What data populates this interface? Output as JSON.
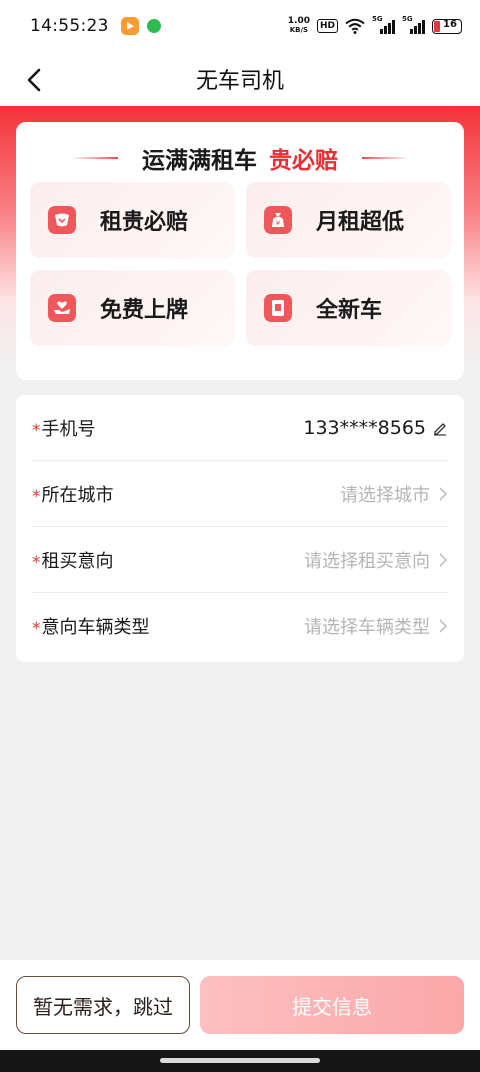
{
  "status_bar": {
    "time": "14:55:23",
    "net_speed_value": "1.00",
    "net_speed_unit": "KB/S",
    "hd_badge": "HD",
    "signal_1_label": "5G",
    "signal_2_label": "5G",
    "battery_level": "16",
    "battery_color": "#e8323c"
  },
  "nav": {
    "title": "无车司机",
    "back_icon": "chevron-left-icon"
  },
  "benefits": {
    "brand": "运满满租车",
    "accent": "贵必赔",
    "accent_color": "#ea2f34",
    "tiles": [
      {
        "label": "租贵必赔",
        "icon": "guarantee-icon"
      },
      {
        "label": "月租超低",
        "icon": "money-bag-icon"
      },
      {
        "label": "免费上牌",
        "icon": "heart-hand-icon"
      },
      {
        "label": "全新车",
        "icon": "new-car-icon"
      }
    ]
  },
  "form": {
    "required_mark": "*",
    "rows": [
      {
        "label": "手机号",
        "value": "133****8565",
        "kind": "filled"
      },
      {
        "label": "所在城市",
        "value": "请选择城市",
        "kind": "placeholder"
      },
      {
        "label": "租买意向",
        "value": "请选择租买意向",
        "kind": "placeholder"
      },
      {
        "label": "意向车辆类型",
        "value": "请选择车辆类型",
        "kind": "placeholder"
      }
    ]
  },
  "actions": {
    "skip_label": "暂无需求，跳过",
    "submit_label": "提交信息",
    "submit_color": "#fba7a9"
  }
}
